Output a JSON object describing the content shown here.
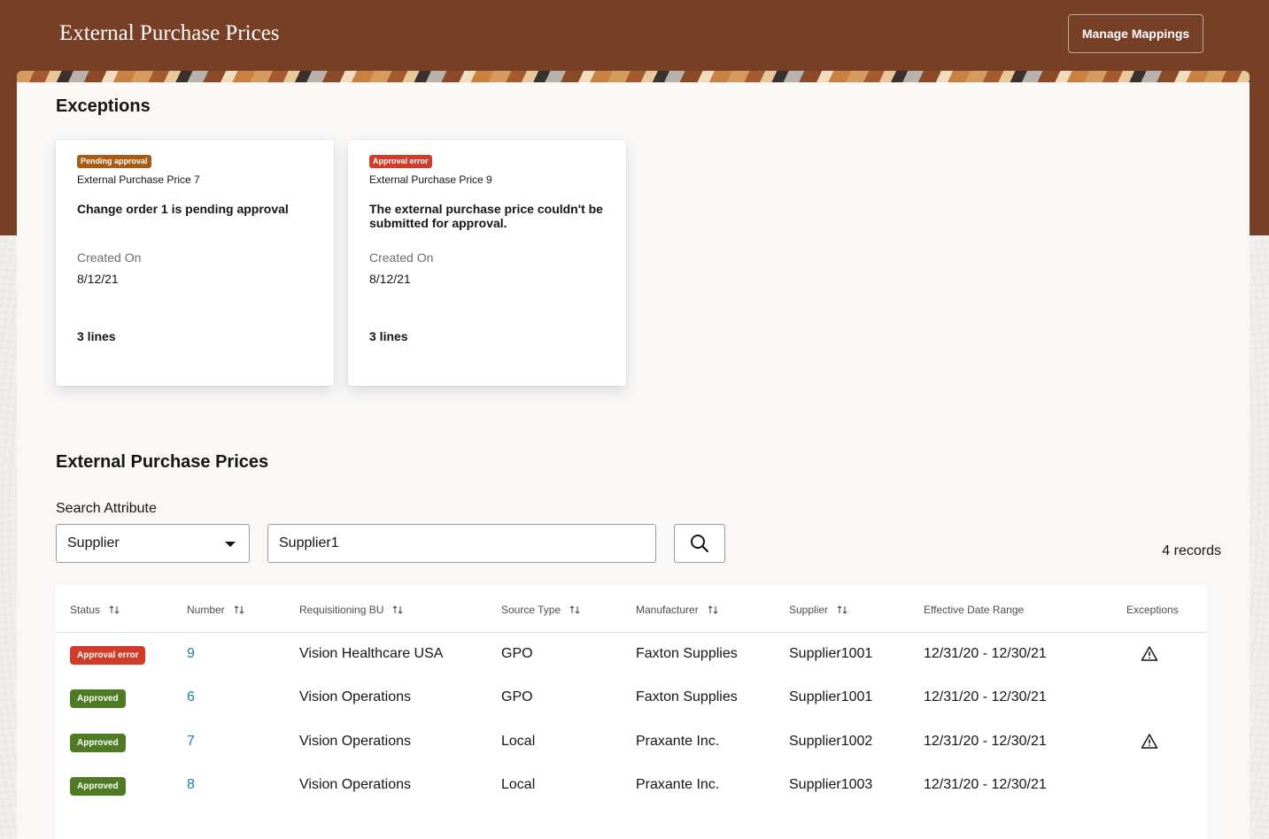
{
  "header": {
    "title": "External Purchase Prices",
    "manage_button": "Manage Mappings"
  },
  "colors": {
    "header_bg": "#773f26",
    "pending": "#a85b12",
    "error": "#d13c29",
    "approved": "#4e7b23",
    "link": "#227e9e"
  },
  "exceptions": {
    "title": "Exceptions",
    "cards": [
      {
        "badge": "Pending approval",
        "badge_type": "pending",
        "reference": "External Purchase Price 7",
        "message": "Change order 1 is pending approval",
        "created_label": "Created On",
        "created_value": "8/12/21",
        "lines": "3 lines"
      },
      {
        "badge": "Approval error",
        "badge_type": "error",
        "reference": "External Purchase Price 9",
        "message": "The external purchase price couldn't be submitted for approval.",
        "created_label": "Created On",
        "created_value": "8/12/21",
        "lines": "3 lines"
      }
    ]
  },
  "prices": {
    "title": "External Purchase Prices",
    "search": {
      "label": "Search Attribute",
      "attribute": "Supplier",
      "value": "Supplier1",
      "icon": "search-icon"
    },
    "records": "4 records",
    "columns": [
      "Status",
      "Number",
      "Requisitioning BU",
      "Source Type",
      "Manufacturer",
      "Supplier",
      "Effective Date Range",
      "Exceptions"
    ],
    "rows": [
      {
        "status": "Approval error",
        "status_type": "error",
        "number": "9",
        "bu": "Vision Healthcare USA",
        "source": "GPO",
        "manufacturer": "Faxton Supplies",
        "supplier": "Supplier1001",
        "dates": "12/31/20 - 12/30/21",
        "exception": true
      },
      {
        "status": "Approved",
        "status_type": "approved",
        "number": "6",
        "bu": "Vision Operations",
        "source": "GPO",
        "manufacturer": "Faxton Supplies",
        "supplier": "Supplier1001",
        "dates": "12/31/20 - 12/30/21",
        "exception": false
      },
      {
        "status": "Approved",
        "status_type": "approved",
        "number": "7",
        "bu": "Vision Operations",
        "source": "Local",
        "manufacturer": "Praxante Inc.",
        "supplier": "Supplier1002",
        "dates": "12/31/20 - 12/30/21",
        "exception": true
      },
      {
        "status": "Approved",
        "status_type": "approved",
        "number": "8",
        "bu": "Vision Operations",
        "source": "Local",
        "manufacturer": "Praxante Inc.",
        "supplier": "Supplier1003",
        "dates": "12/31/20 - 12/30/21",
        "exception": false
      }
    ]
  }
}
